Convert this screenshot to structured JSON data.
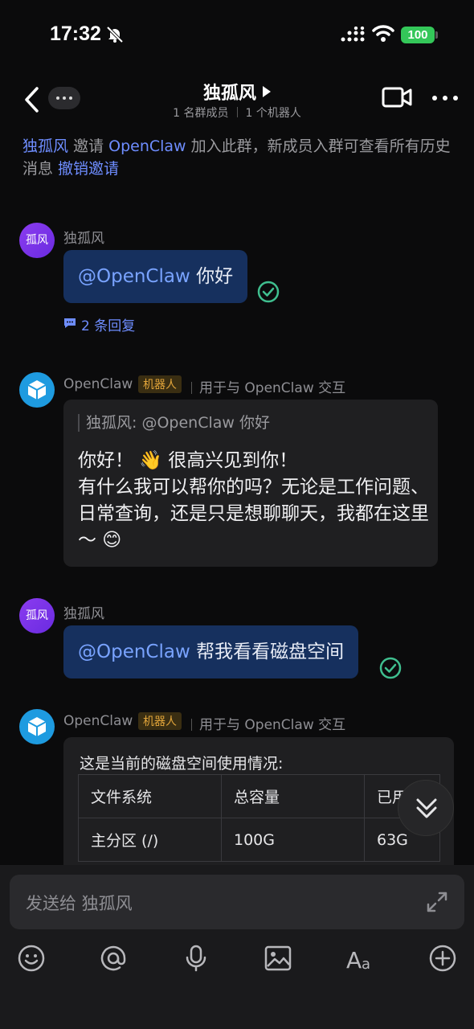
{
  "status_bar": {
    "time": "17:32",
    "battery": "100"
  },
  "header": {
    "title": "独孤风",
    "member_count": "1 名群成员",
    "bot_count": "1 个机器人"
  },
  "notice": {
    "inviter": "独孤风",
    "invite_text": " 邀请 ",
    "invitee": "OpenClaw",
    "rest": " 加入此群，新成员入群可查看所有历史消息 ",
    "revoke": "撤销邀请"
  },
  "messages": [
    {
      "sender": "独孤风",
      "avatar_text": "孤风",
      "mention": "@OpenClaw",
      "text": " 你好",
      "reply_count": "2 条回复"
    },
    {
      "sender": "OpenClaw",
      "tag": "机器人",
      "desc": "用于与 OpenClaw 交互",
      "quote": "独孤风: @OpenClaw 你好",
      "text": "你好！ 👋 很高兴见到你！\n有什么我可以帮你的吗？无论是工作问题、日常查询，还是只是想聊聊天，我都在这里～ 😊"
    },
    {
      "sender": "独孤风",
      "avatar_text": "孤风",
      "mention": "@OpenClaw",
      "text": " 帮我看看磁盘空间"
    },
    {
      "sender": "OpenClaw",
      "tag": "机器人",
      "desc": "用于与 OpenClaw 交互",
      "intro": "这是当前的磁盘空间使用情况:",
      "table": {
        "headers": [
          "文件系统",
          "总容量",
          "已用"
        ],
        "rows": [
          [
            "主分区 (/)",
            "100G",
            "63G"
          ]
        ]
      }
    }
  ],
  "compose": {
    "placeholder": "发送给 独孤风"
  },
  "colors": {
    "accent": "#6e8dff",
    "my_bubble": "#16305e",
    "bot_tag": "#e2a53a"
  }
}
